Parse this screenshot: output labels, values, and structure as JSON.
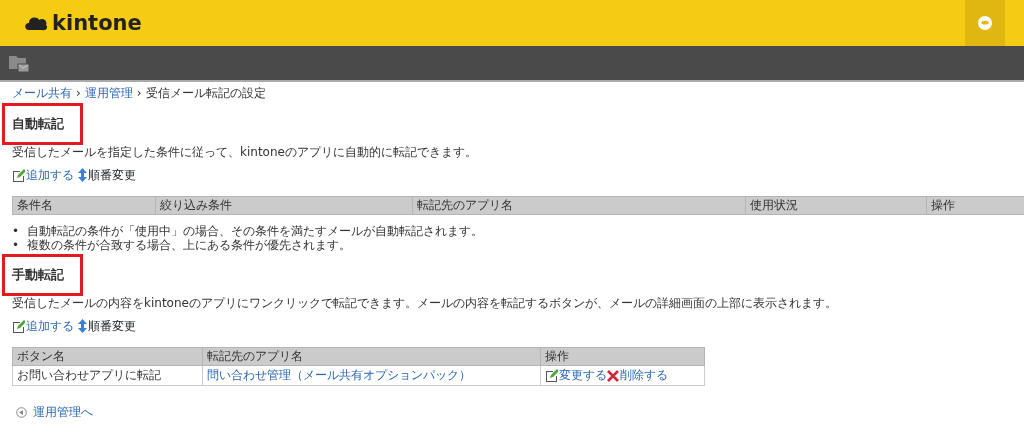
{
  "header": {
    "logo_text": "kintone"
  },
  "breadcrumb": [
    {
      "label": "メール共有",
      "kind": "link"
    },
    {
      "label": "›",
      "kind": "separator"
    },
    {
      "label": "運用管理",
      "kind": "link"
    },
    {
      "label": "›",
      "kind": "separator"
    },
    {
      "label": "受信メール転記の設定",
      "kind": "current"
    }
  ],
  "sections": [
    {
      "title": "自動転記",
      "highlighted": true,
      "description": "受信したメールを指定した条件に従って、kintoneのアプリに自動的に転記できます。",
      "actions": [
        {
          "label": "追加する",
          "kind": "add"
        },
        {
          "label": "順番変更",
          "kind": "reorder"
        }
      ],
      "table": {
        "full_width": true,
        "columns": [
          "条件名",
          "絞り込み条件",
          "転記先のアプリ名",
          "使用状況",
          "操作"
        ]
      },
      "notes": [
        {
          "marker": "•",
          "text": "自動転記の条件が「使用中」の場合、その条件を満たすメールが自動転記されます。"
        },
        {
          "marker": "•",
          "text": "複数の条件が合致する場合、上にある条件が優先されます。"
        }
      ]
    },
    {
      "title": "手動転記",
      "highlighted": true,
      "description": "受信したメールの内容をkintoneのアプリにワンクリックで転記できます。メールの内容を転記するボタンが、メールの詳細画面の上部に表示されます。",
      "actions": [
        {
          "label": "追加する",
          "kind": "add"
        },
        {
          "label": "順番変更",
          "kind": "reorder"
        }
      ],
      "table": {
        "full_width": false,
        "columns": [
          "ボタン名",
          "転記先のアプリ名",
          "操作"
        ],
        "rows": [
          [
            {
              "kind": "text",
              "text": "お問い合わせアプリに転記"
            },
            {
              "kind": "link",
              "text": "問い合わせ管理（メール共有オプションパック）"
            },
            {
              "kind": "ops",
              "items": [
                {
                  "kind": "edit",
                  "label": "変更する"
                },
                {
                  "kind": "delete",
                  "label": "削除する"
                }
              ]
            }
          ]
        ]
      }
    }
  ],
  "back_link": {
    "label": "運用管理へ"
  }
}
